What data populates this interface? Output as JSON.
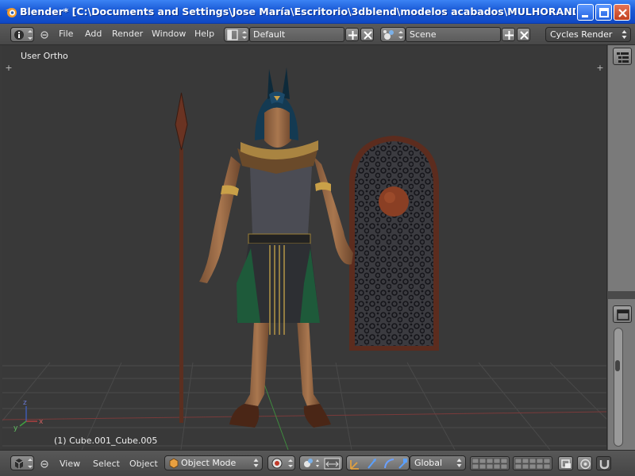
{
  "window": {
    "title": "Blender* [C:\\Documents and Settings\\Jose María\\Escritorio\\3dblend\\modelos acabados\\MULHORAND\\clerigos\\c...",
    "controls": [
      "minimize-icon",
      "maximize-icon",
      "close-icon"
    ]
  },
  "top_header": {
    "editor_type_icon": "info-icon",
    "menus": [
      "File",
      "Add",
      "Render",
      "Window",
      "Help"
    ],
    "screen_layout": "Default",
    "scene": "Scene",
    "render_engine": "Cycles Render"
  },
  "viewport": {
    "view_label": "User Ortho",
    "object_label": "(1) Cube.001_Cube.005",
    "axis_labels": {
      "x": "x",
      "y": "y",
      "z": "z"
    }
  },
  "bottom_header": {
    "editor_type_icon": "3d-view-icon",
    "menus": [
      "View",
      "Select",
      "Object"
    ],
    "mode": "Object Mode",
    "orientation": "Global"
  },
  "colors": {
    "title_bar": "#1a5ad6",
    "header_bg": "#4f4f4f",
    "viewport_bg": "#393939",
    "grid_line": "#494949",
    "x_axis": "#8a3a3a",
    "y_axis": "#3f8a3f"
  }
}
